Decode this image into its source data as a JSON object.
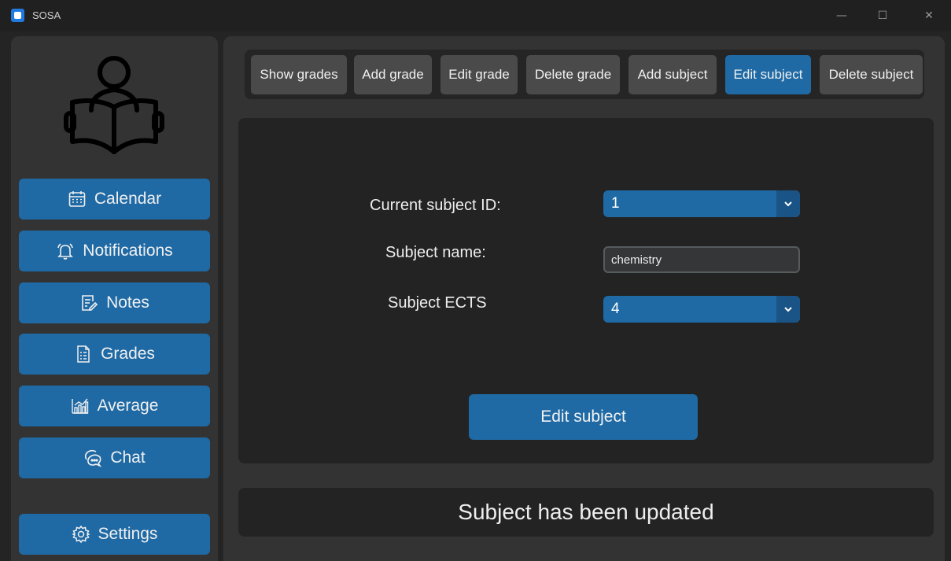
{
  "window": {
    "title": "SOSA",
    "controls": {
      "minimize": "—",
      "maximize": "☐",
      "close": "✕"
    }
  },
  "sidebar": {
    "logo_icon": "reader-book-icon",
    "items": [
      {
        "label": "Calendar",
        "icon": "calendar-icon"
      },
      {
        "label": "Notifications",
        "icon": "bell-icon"
      },
      {
        "label": "Notes",
        "icon": "notes-icon"
      },
      {
        "label": "Grades",
        "icon": "grades-icon"
      },
      {
        "label": "Average",
        "icon": "chart-icon"
      },
      {
        "label": "Chat",
        "icon": "chat-icon"
      },
      {
        "label": "Settings",
        "icon": "gear-icon"
      }
    ]
  },
  "toolbar": {
    "buttons": [
      {
        "label": "Show grades"
      },
      {
        "label": "Add grade"
      },
      {
        "label": "Edit grade"
      },
      {
        "label": "Delete grade"
      },
      {
        "label": "Add subject"
      },
      {
        "label": "Edit subject"
      },
      {
        "label": "Delete subject"
      }
    ],
    "active": "Edit subject"
  },
  "form": {
    "subject_id_label": "Current subject ID:",
    "subject_id_value": "1",
    "subject_name_label": "Subject name:",
    "subject_name_value": "chemistry",
    "subject_ects_label": "Subject ECTS",
    "subject_ects_value": "4",
    "submit_label": "Edit subject"
  },
  "status": {
    "message": "Subject has been updated"
  },
  "colors": {
    "accent": "#1f6aa5",
    "panel": "#333333",
    "background": "#242424"
  }
}
